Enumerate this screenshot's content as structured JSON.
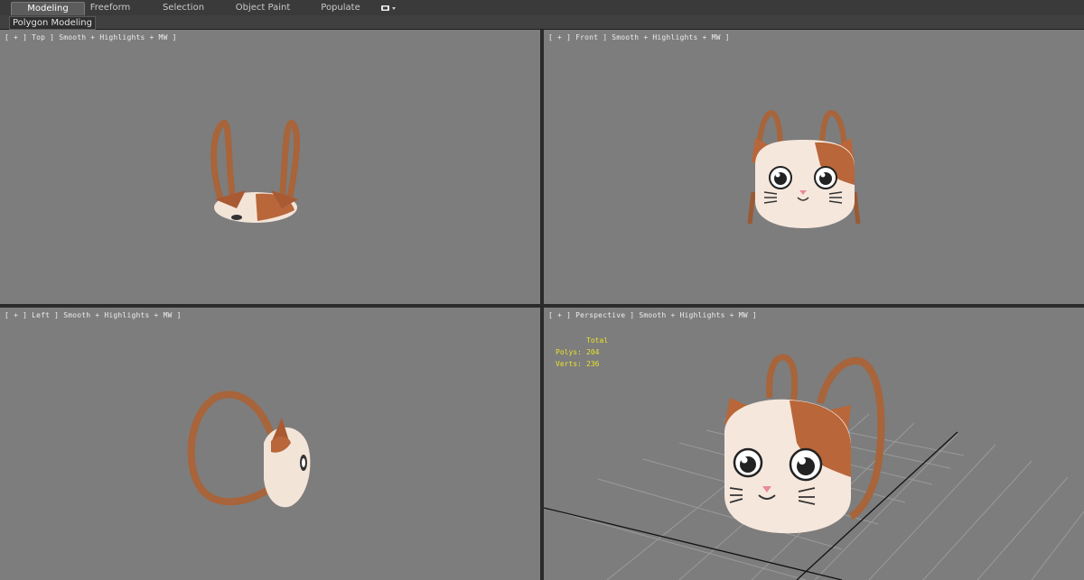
{
  "ribbon": {
    "tabs": [
      {
        "label": "Modeling",
        "active": true
      },
      {
        "label": "Freeform",
        "active": false
      },
      {
        "label": "Selection",
        "active": false
      },
      {
        "label": "Object Paint",
        "active": false
      },
      {
        "label": "Populate",
        "active": false
      }
    ],
    "extra_icon": "view-options-icon",
    "panel_label": "Polygon Modeling"
  },
  "viewports": {
    "top": {
      "label": "[ + ] Top ] Smooth + Highlights + MW ]"
    },
    "front": {
      "label": "[ + ] Front ] Smooth + Highlights + MW ]"
    },
    "left": {
      "label": "[ + ] Left ] Smooth + Highlights + MW ]"
    },
    "perspective": {
      "label": "[ + ] Perspective ] Smooth + Highlights + MW ]",
      "stats": {
        "header": "Total",
        "polys_label": "Polys:",
        "polys_value": "204",
        "verts_label": "Verts:",
        "verts_value": "236"
      }
    }
  },
  "colors": {
    "viewport_bg": "#7d7d7d",
    "stats_text": "#e8e22a",
    "cat_white": "#f6e7dc",
    "cat_brown": "#b8663a",
    "strap": "#a8643a"
  }
}
